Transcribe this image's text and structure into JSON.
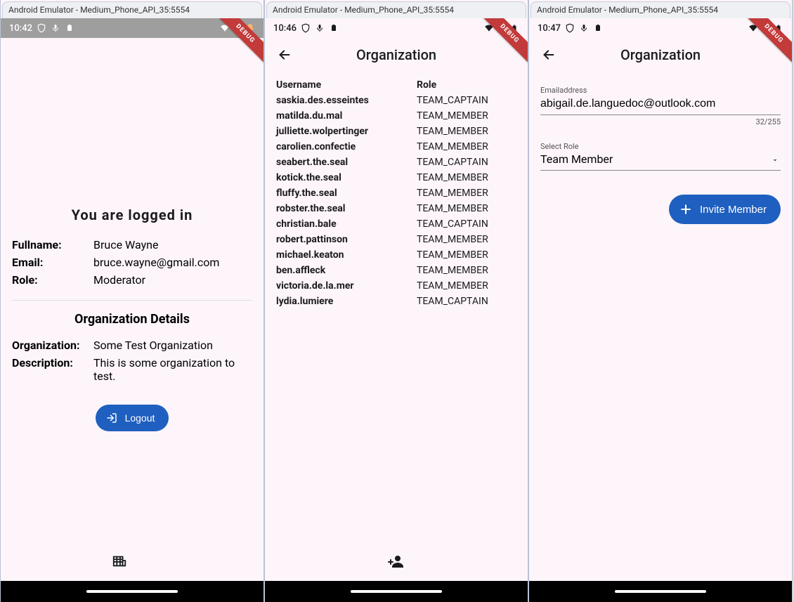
{
  "window_title": "Android Emulator - Medium_Phone_API_35:5554",
  "debug_label": "DEBUG",
  "navbar": {
    "handle": ""
  },
  "screen1": {
    "status": {
      "time": "10:42"
    },
    "logged_in_title": "You are logged in",
    "labels": {
      "fullname": "Fullname:",
      "email": "Email:",
      "role": "Role:"
    },
    "values": {
      "fullname": "Bruce Wayne",
      "email": "bruce.wayne@gmail.com",
      "role": "Moderator"
    },
    "org_title": "Organization Details",
    "org_labels": {
      "organization": "Organization:",
      "description": "Description:"
    },
    "org_values": {
      "organization": "Some Test Organization",
      "description": "This is some organization to test."
    },
    "logout_label": "Logout"
  },
  "screen2": {
    "status": {
      "time": "10:46"
    },
    "title": "Organization",
    "headers": {
      "username": "Username",
      "role": "Role"
    },
    "rows": [
      {
        "username": "saskia.des.esseintes",
        "role": "TEAM_CAPTAIN"
      },
      {
        "username": "matilda.du.mal",
        "role": "TEAM_MEMBER"
      },
      {
        "username": "julliette.wolpertinger",
        "role": "TEAM_MEMBER"
      },
      {
        "username": "carolien.confectie",
        "role": "TEAM_MEMBER"
      },
      {
        "username": "seabert.the.seal",
        "role": "TEAM_CAPTAIN"
      },
      {
        "username": "kotick.the.seal",
        "role": "TEAM_MEMBER"
      },
      {
        "username": "fluffy.the.seal",
        "role": "TEAM_MEMBER"
      },
      {
        "username": "robster.the.seal",
        "role": "TEAM_MEMBER"
      },
      {
        "username": "christian.bale",
        "role": "TEAM_CAPTAIN"
      },
      {
        "username": "robert.pattinson",
        "role": "TEAM_MEMBER"
      },
      {
        "username": "michael.keaton",
        "role": "TEAM_MEMBER"
      },
      {
        "username": "ben.affleck",
        "role": "TEAM_MEMBER"
      },
      {
        "username": "victoria.de.la.mer",
        "role": "TEAM_MEMBER"
      },
      {
        "username": "lydia.lumiere",
        "role": "TEAM_CAPTAIN"
      }
    ]
  },
  "screen3": {
    "status": {
      "time": "10:47"
    },
    "title": "Organization",
    "email_label": "Emailaddress",
    "email_value": "abigail.de.languedoc@outlook.com",
    "email_counter": "32/255",
    "role_label": "Select Role",
    "role_value": "Team Member",
    "invite_label": "Invite Member"
  }
}
